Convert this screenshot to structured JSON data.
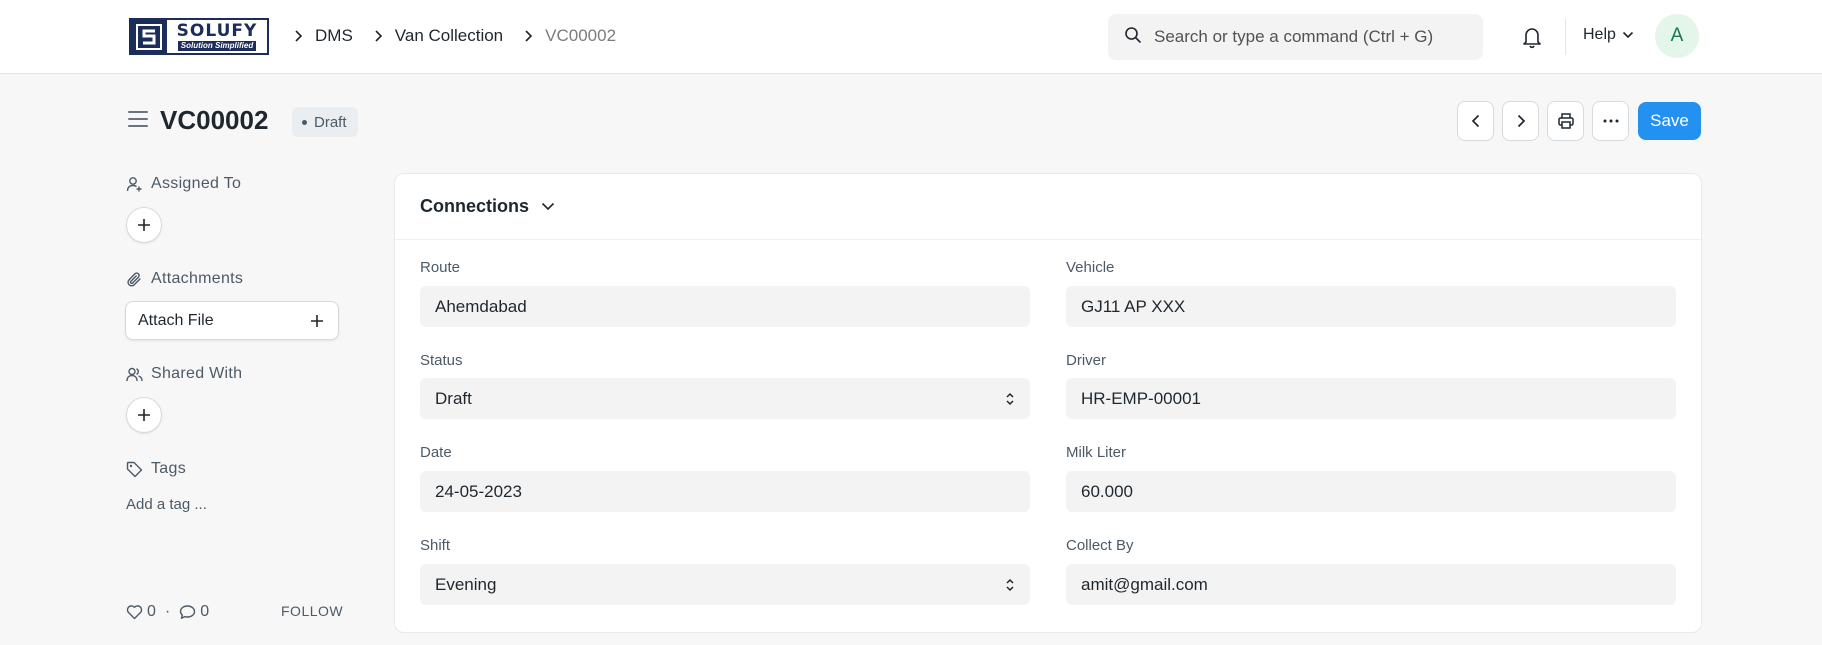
{
  "brand": {
    "name": "SOLUFY",
    "tagline": "Solution Simplified"
  },
  "breadcrumbs": [
    "DMS",
    "Van Collection",
    "VC00002"
  ],
  "search": {
    "placeholder": "Search or type a command (Ctrl + G)"
  },
  "navbar": {
    "help_label": "Help",
    "avatar_initial": "A"
  },
  "page": {
    "title": "VC00002",
    "status": "Draft"
  },
  "actions": {
    "save_label": "Save"
  },
  "sidebar": {
    "assigned_to": "Assigned To",
    "attachments": "Attachments",
    "attach_file": "Attach File",
    "shared_with": "Shared With",
    "tags": "Tags",
    "add_tag": "Add a tag ...",
    "likes_count": "0",
    "comments_count": "0",
    "follow_label": "FOLLOW"
  },
  "section": {
    "title": "Connections"
  },
  "fields": {
    "route": {
      "label": "Route",
      "value": "Ahemdabad"
    },
    "vehicle": {
      "label": "Vehicle",
      "value": "GJ11 AP XXX"
    },
    "status": {
      "label": "Status",
      "value": "Draft"
    },
    "driver": {
      "label": "Driver",
      "value": "HR-EMP-00001"
    },
    "date": {
      "label": "Date",
      "value": "24-05-2023"
    },
    "milk_liter": {
      "label": "Milk Liter",
      "value": "60.000"
    },
    "shift": {
      "label": "Shift",
      "value": "Evening"
    },
    "collect_by": {
      "label": "Collect By",
      "value": "amit@gmail.com"
    }
  },
  "colors": {
    "primary": "#2490ef",
    "brand_navy": "#1c2d5a",
    "avatar_bg": "#e4f5e9",
    "avatar_fg": "#16794c"
  }
}
